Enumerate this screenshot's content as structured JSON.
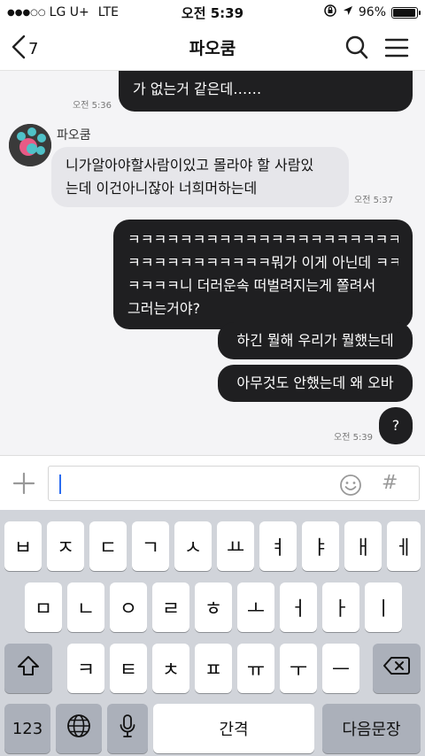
{
  "status_bar": {
    "signal": "●●●○○",
    "carrier": "LG U+",
    "network": "LTE",
    "time": "오전 5:39",
    "battery": "96%",
    "battery_level": 0.96
  },
  "header": {
    "back_count": "7",
    "title": "파오쿰"
  },
  "chat": {
    "messages": [
      {
        "side": "right",
        "text": "가 없는거 같은데……",
        "time": "오전 5:36"
      },
      {
        "side": "left",
        "sender": "파오쿰",
        "lines": [
          "니가알아야할사람이있고 몰라야 할 사람있",
          "는데 이건아니잖아 너희머하는데"
        ],
        "time": "오전 5:37"
      },
      {
        "side": "right",
        "lines": [
          "ㅋㅋㅋㅋㅋㅋㅋㅋㅋㅋㅋㅋㅋㅋㅋㅋㅋㅋㅋㅋㅋㅋ",
          "ㅋㅋㅋㅋㅋㅋㅋㅋㅋㅋㅋ뭐가 이게 아닌데 ㅋㅋ",
          "ㅋㅋㅋㅋ니 더러운속 떠벌려지는게 쫄려서",
          "그러는거야?"
        ]
      },
      {
        "side": "right",
        "text": "하긴 뭘해 우리가 뭘했는데"
      },
      {
        "side": "right",
        "text": "아무것도 안했는데 왜 오바"
      },
      {
        "side": "right",
        "text": "?",
        "time": "오전 5:39"
      }
    ]
  },
  "input": {
    "value": ""
  },
  "keyboard": {
    "row1": [
      "ㅂ",
      "ㅈ",
      "ㄷ",
      "ㄱ",
      "ㅅ",
      "ㅛ",
      "ㅕ",
      "ㅑ",
      "ㅐ",
      "ㅔ"
    ],
    "row2": [
      "ㅁ",
      "ㄴ",
      "ㅇ",
      "ㄹ",
      "ㅎ",
      "ㅗ",
      "ㅓ",
      "ㅏ",
      "ㅣ"
    ],
    "row3": [
      "ㅋ",
      "ㅌ",
      "ㅊ",
      "ㅍ",
      "ㅠ",
      "ㅜ",
      "ㅡ"
    ],
    "numbers_key": "123",
    "space_key": "간격",
    "return_key": "다음문장"
  }
}
